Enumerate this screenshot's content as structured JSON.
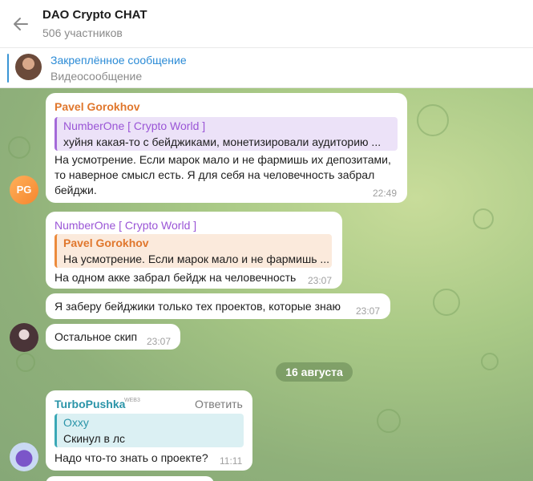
{
  "header": {
    "title": "DAO Crypto CHAT",
    "subtitle": "506 участников"
  },
  "pinned": {
    "title": "Закреплённое сообщение",
    "subtitle": "Видеосообщение"
  },
  "colors": {
    "accent": "#2b8bd6",
    "pavel": "#e0772d",
    "numberone": "#9a55d6",
    "turbo": "#2a94a8"
  },
  "messages": [
    {
      "sender": "Pavel Gorokhov",
      "avatar_initials": "PG",
      "quote_name": "NumberOne [ Crypto World ]",
      "quote_text": "хуйня какая-то с бейджиками,  монетизировали аудиторию ...",
      "lines": [
        "На усмотрение. Если марок мало и не фармишь их депозитами,",
        "то наверное смысл есть. Я для себя на человечность забрал",
        "бейджи."
      ],
      "time": "22:49"
    },
    {
      "sender": "NumberOne [ Crypto World ]",
      "quote_name": "Pavel Gorokhov",
      "quote_text": "На усмотрение. Если марок мало и не фармишь ...",
      "text": "На одном акке забрал бейдж на человечность",
      "time": "23:07"
    },
    {
      "text": "Я заберу бейджики только тех проектов, которые знаю",
      "time": "23:07"
    },
    {
      "text": "Остальное скип",
      "time": "23:07"
    },
    {
      "sender": "TurboPushka",
      "badge": "WEB3",
      "reply_label": "Ответить",
      "quote_name": "Oxxy",
      "quote_text": "Скинул в лс",
      "text": "Надо что-то знать о проекте?",
      "time": "11:11"
    }
  ],
  "date_separator": "16 августа"
}
